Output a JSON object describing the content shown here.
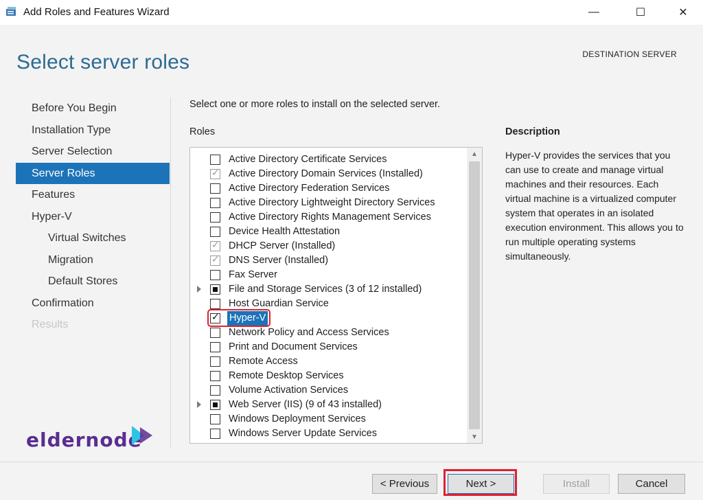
{
  "window": {
    "title": "Add Roles and Features Wizard",
    "minimize": "—",
    "maximize": "☐",
    "close": "✕"
  },
  "header": {
    "title": "Select server roles",
    "destination": "DESTINATION SERVER"
  },
  "nav": {
    "items": [
      {
        "label": "Before You Begin"
      },
      {
        "label": "Installation Type"
      },
      {
        "label": "Server Selection"
      },
      {
        "label": "Server Roles"
      },
      {
        "label": "Features"
      },
      {
        "label": "Hyper-V"
      },
      {
        "label": "Virtual Switches"
      },
      {
        "label": "Migration"
      },
      {
        "label": "Default Stores"
      },
      {
        "label": "Confirmation"
      },
      {
        "label": "Results"
      }
    ]
  },
  "main": {
    "instruction": "Select one or more roles to install on the selected server.",
    "roles_header": "Roles",
    "description_header": "Description",
    "description": "Hyper-V provides the services that you can use to create and manage virtual machines and their resources. Each virtual machine is a virtualized computer system that operates in an isolated execution environment. This allows you to run multiple operating systems simultaneously."
  },
  "roles": [
    {
      "label": "Active Directory Certificate Services",
      "state": "unchecked"
    },
    {
      "label": "Active Directory Domain Services (Installed)",
      "state": "installed"
    },
    {
      "label": "Active Directory Federation Services",
      "state": "unchecked"
    },
    {
      "label": "Active Directory Lightweight Directory Services",
      "state": "unchecked"
    },
    {
      "label": "Active Directory Rights Management Services",
      "state": "unchecked"
    },
    {
      "label": "Device Health Attestation",
      "state": "unchecked"
    },
    {
      "label": "DHCP Server (Installed)",
      "state": "installed"
    },
    {
      "label": "DNS Server (Installed)",
      "state": "installed"
    },
    {
      "label": "Fax Server",
      "state": "unchecked"
    },
    {
      "label": "File and Storage Services (3 of 12 installed)",
      "state": "partial",
      "expandable": true
    },
    {
      "label": "Host Guardian Service",
      "state": "unchecked"
    },
    {
      "label": "Hyper-V",
      "state": "checked",
      "selected": true
    },
    {
      "label": "Network Policy and Access Services",
      "state": "unchecked"
    },
    {
      "label": "Print and Document Services",
      "state": "unchecked"
    },
    {
      "label": "Remote Access",
      "state": "unchecked"
    },
    {
      "label": "Remote Desktop Services",
      "state": "unchecked"
    },
    {
      "label": "Volume Activation Services",
      "state": "unchecked"
    },
    {
      "label": "Web Server (IIS) (9 of 43 installed)",
      "state": "partial",
      "expandable": true
    },
    {
      "label": "Windows Deployment Services",
      "state": "unchecked"
    },
    {
      "label": "Windows Server Update Services",
      "state": "unchecked"
    }
  ],
  "logo": {
    "text": "eldernode"
  },
  "footer": {
    "previous": "< Previous",
    "next": "Next >",
    "install": "Install",
    "cancel": "Cancel"
  },
  "colors": {
    "accent": "#1c73b8",
    "title_blue": "#2b6b93",
    "highlight_red": "#e0202e",
    "logo_purple": "#5a2d91",
    "logo_cyan": "#2ec4e6"
  }
}
